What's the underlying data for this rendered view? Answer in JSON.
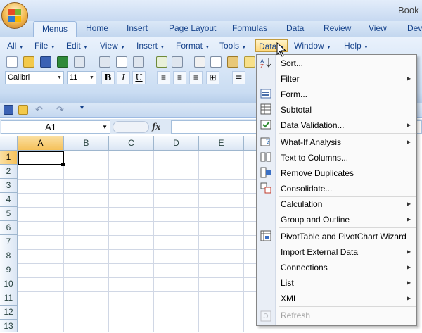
{
  "window": {
    "title": "Book"
  },
  "ribbon_tabs": [
    {
      "label": "Menus",
      "active": true
    },
    {
      "label": "Home"
    },
    {
      "label": "Insert"
    },
    {
      "label": "Page Layout"
    },
    {
      "label": "Formulas"
    },
    {
      "label": "Data"
    },
    {
      "label": "Review"
    },
    {
      "label": "View"
    },
    {
      "label": "Deve"
    }
  ],
  "menubar": [
    {
      "label": "All"
    },
    {
      "label": "File"
    },
    {
      "label": "Edit"
    },
    {
      "label": "View"
    },
    {
      "label": "Insert"
    },
    {
      "label": "Format"
    },
    {
      "label": "Tools"
    },
    {
      "label": "Data",
      "active": true
    },
    {
      "label": "Window"
    },
    {
      "label": "Help"
    }
  ],
  "font": {
    "name": "Calibri",
    "size": "11"
  },
  "format_buttons": {
    "bold": "B",
    "italic": "I",
    "underline": "U"
  },
  "formula_bar": {
    "name_box": "A1",
    "fx_label": "fx",
    "value": ""
  },
  "columns": [
    "A",
    "B",
    "C",
    "D",
    "E"
  ],
  "rows": [
    "1",
    "2",
    "3",
    "4",
    "5",
    "6",
    "7",
    "8",
    "9",
    "10",
    "11",
    "12",
    "13"
  ],
  "active_cell": "A1",
  "data_menu": {
    "items": [
      {
        "label": "Sort...",
        "submenu": false,
        "icon": "sort-icon"
      },
      {
        "label": "Filter",
        "submenu": true,
        "icon": ""
      },
      {
        "label": "Form...",
        "submenu": false,
        "icon": "form-icon"
      },
      {
        "label": "Subtotal",
        "submenu": false,
        "icon": "subtotal-icon"
      },
      {
        "label": "Data Validation...",
        "submenu": true,
        "icon": "data-validation-icon"
      },
      {
        "label": "What-If Analysis",
        "submenu": true,
        "icon": "what-if-icon"
      },
      {
        "label": "Text to Columns...",
        "submenu": false,
        "icon": "text-to-columns-icon"
      },
      {
        "label": "Remove Duplicates",
        "submenu": false,
        "icon": "remove-duplicates-icon"
      },
      {
        "label": "Consolidate...",
        "submenu": false,
        "icon": "consolidate-icon"
      },
      {
        "label": "Calculation",
        "submenu": true,
        "icon": ""
      },
      {
        "label": "Group and Outline",
        "submenu": true,
        "icon": ""
      },
      {
        "label": "PivotTable and PivotChart Wizard",
        "submenu": false,
        "icon": "pivottable-icon"
      },
      {
        "label": "Import External Data",
        "submenu": true,
        "icon": ""
      },
      {
        "label": "Connections",
        "submenu": true,
        "icon": ""
      },
      {
        "label": "List",
        "submenu": true,
        "icon": ""
      },
      {
        "label": "XML",
        "submenu": true,
        "icon": ""
      },
      {
        "label": "Refresh",
        "submenu": false,
        "icon": "refresh-icon",
        "disabled": true
      }
    ]
  },
  "colors": {
    "accent": "#15428b",
    "highlight": "#ffd77a",
    "selected_header": "#f5c15a"
  }
}
